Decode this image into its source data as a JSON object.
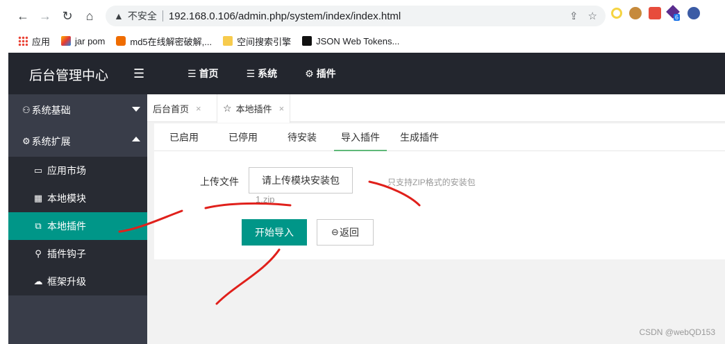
{
  "browser": {
    "nav": {
      "back": "←",
      "forward": "→",
      "reload": "↻",
      "home": "⌂"
    },
    "omnibox": {
      "warning_icon": "warning-icon",
      "insecure_label": "不安全",
      "url": "192.168.0.106/admin.php/system/index/index.html"
    },
    "extension_badge": "6",
    "bookmarks": [
      {
        "label": "应用",
        "icon": "apps-grid-icon"
      },
      {
        "label": "jar pom",
        "icon": "chart-logo-icon"
      },
      {
        "label": "md5在线解密破解,...",
        "icon": "orange-c-icon"
      },
      {
        "label": "空间搜索引擎",
        "icon": "folder-icon"
      },
      {
        "label": "JSON Web Tokens...",
        "icon": "jwt-icon"
      }
    ]
  },
  "app": {
    "brand": "后台管理中心",
    "topnav": [
      {
        "label": "首页",
        "icon": "list-icon"
      },
      {
        "label": "系统",
        "icon": "list-icon"
      },
      {
        "label": "插件",
        "icon": "gear-icon"
      }
    ],
    "sidebar": {
      "groups": [
        {
          "label": "系统基础",
          "icon": "modules-icon"
        },
        {
          "label": "系统扩展",
          "icon": "gear-icon"
        }
      ],
      "items": [
        {
          "label": "应用市场",
          "icon": "store-icon"
        },
        {
          "label": "本地模块",
          "icon": "grid-icon"
        },
        {
          "label": "本地插件",
          "icon": "plugin-icon"
        },
        {
          "label": "插件钩子",
          "icon": "hook-icon"
        },
        {
          "label": "框架升级",
          "icon": "cloud-upgrade-icon"
        }
      ]
    },
    "tabs": [
      {
        "label": "后台首页",
        "close": "×"
      },
      {
        "label": "本地插件",
        "close": "×",
        "icon": "star-icon"
      }
    ],
    "subtabs": [
      "已启用",
      "已停用",
      "待安装",
      "导入插件",
      "生成插件"
    ],
    "form": {
      "upload_label": "上传文件",
      "upload_button": "请上传模块安装包",
      "hint": "只支持ZIP格式的安装包",
      "filename": "1.zip",
      "submit": "开始导入",
      "back": "返回"
    },
    "colors": {
      "primary": "#009688",
      "topbar": "#23262e",
      "sidebar": "#393d49",
      "active_tab_line": "#5fb878"
    }
  },
  "watermark": "CSDN @webQD153"
}
